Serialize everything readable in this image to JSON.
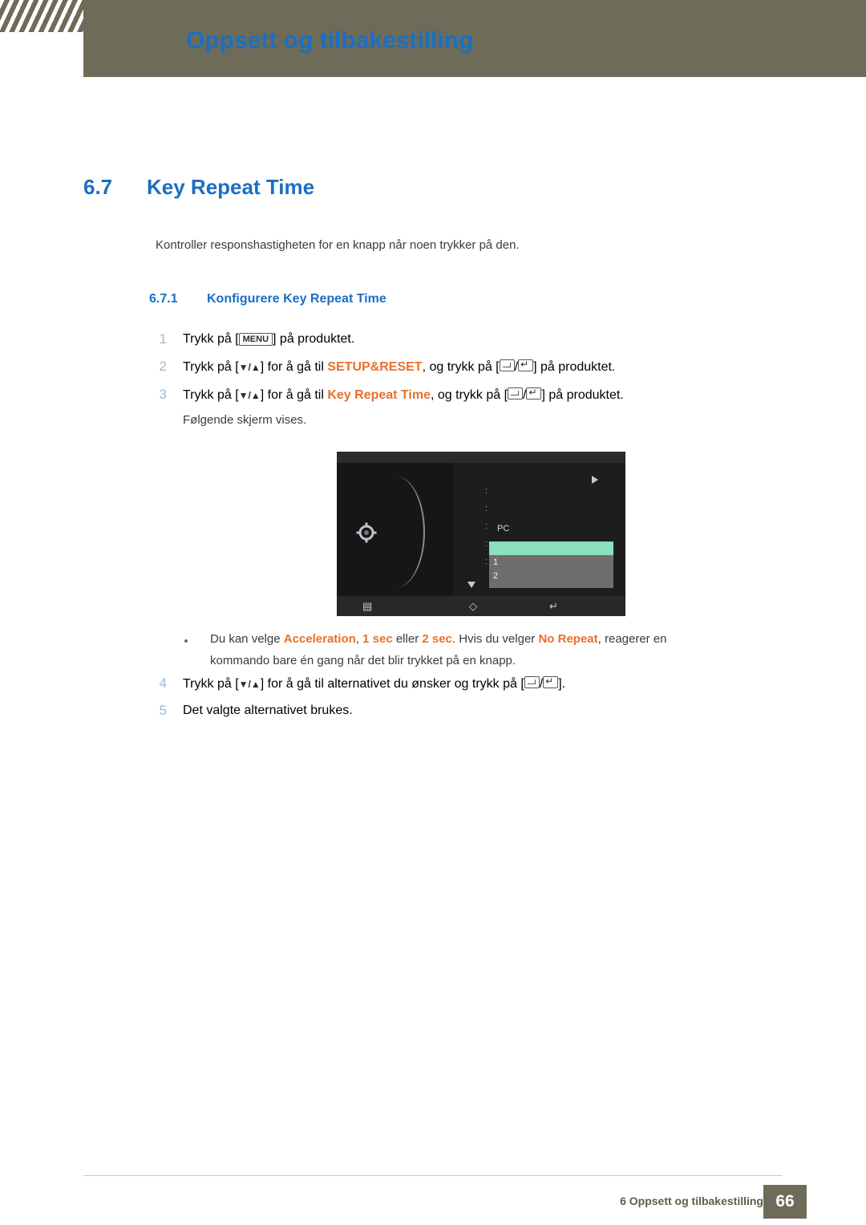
{
  "header": {
    "title": "Oppsett og tilbakestilling",
    "accent": "#1a6fc4",
    "bar_color": "#6e6b58"
  },
  "section": {
    "number": "6.7",
    "title": "Key Repeat Time",
    "intro": "Kontroller responshastigheten for en knapp når noen trykker på den."
  },
  "subsection": {
    "number": "6.7.1",
    "title": "Konfigurere Key Repeat Time"
  },
  "steps": {
    "one": {
      "num": "1",
      "a": "Trykk på [",
      "key": "MENU",
      "b": "] på produktet."
    },
    "two": {
      "num": "2",
      "a": "Trykk på [",
      "arrows": "▼/▲",
      "b": "] for å gå til ",
      "target": "SETUP&RESET",
      "c": ", og trykk på [",
      "d": "] på produktet."
    },
    "three": {
      "num": "3",
      "a": "Trykk på [",
      "arrows": "▼/▲",
      "b": "] for å gå til ",
      "target": "Key Repeat Time",
      "c": ", og trykk på [",
      "d": "] på produktet.",
      "follow": "Følgende skjerm vises."
    },
    "four": {
      "num": "4",
      "a": "Trykk på [",
      "arrows": "▼/▲",
      "b": "] for å gå til alternativet du ønsker og trykk på [",
      "c": "]."
    },
    "five": {
      "num": "5",
      "text": "Det valgte alternativet brukes."
    }
  },
  "bullet": {
    "a": "Du kan velge ",
    "opt1": "Acceleration",
    "sep1": ", ",
    "opt2": "1 sec",
    "sep2": " eller ",
    "opt3": "2 sec",
    "b": ". Hvis du velger ",
    "opt4": "No Repeat",
    "c": ", reagerer en",
    "line2": "kommando bare én gang når det blir trykket på en knapp."
  },
  "osd": {
    "dots": [
      ":",
      ":",
      ":",
      ":",
      ":"
    ],
    "pc_label": "PC",
    "items": [
      "",
      "1",
      "2"
    ],
    "highlight_color": "#8ce0bd",
    "panel_color": "#6e6e70",
    "background": "#1d1d1f"
  },
  "footer": {
    "text": "6 Oppsett og tilbakestilling",
    "page": "66"
  }
}
